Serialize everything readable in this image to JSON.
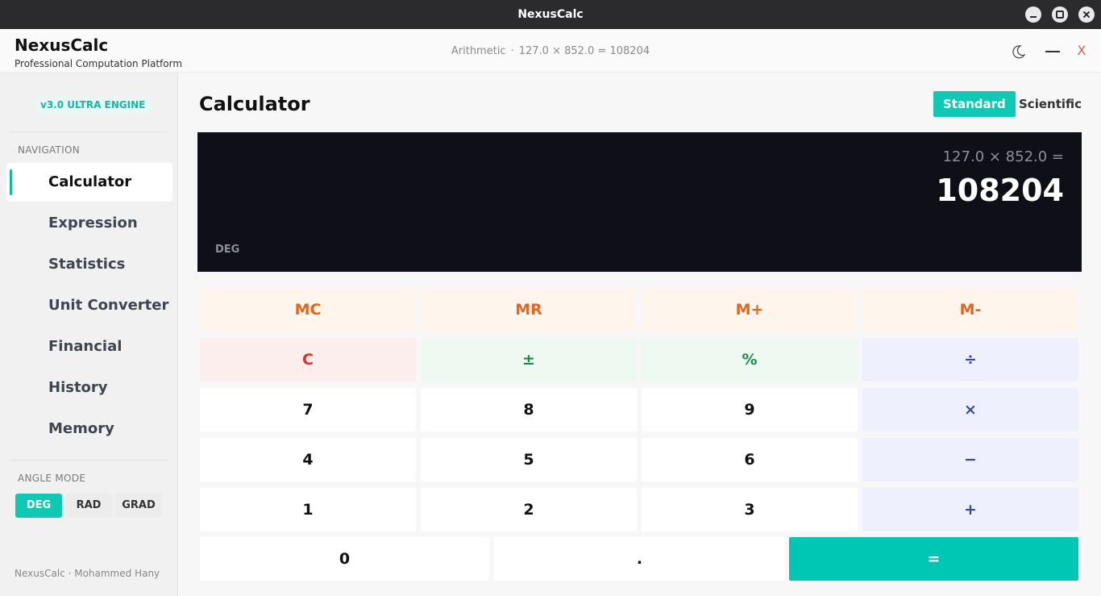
{
  "window": {
    "title": "NexusCalc"
  },
  "header": {
    "brand": "NexusCalc",
    "tagline": "Professional Computation Platform",
    "status_mode": "Arithmetic",
    "status_sep": "·",
    "status_expr": "127.0 × 852.0 = 108204"
  },
  "sidebar": {
    "version": "v3.0  ULTRA ENGINE",
    "nav_label": "NAVIGATION",
    "items": [
      {
        "label": "Calculator",
        "active": true
      },
      {
        "label": "Expression"
      },
      {
        "label": "Statistics"
      },
      {
        "label": "Unit Converter"
      },
      {
        "label": "Financial"
      },
      {
        "label": "History"
      },
      {
        "label": "Memory"
      }
    ],
    "angle_label": "ANGLE MODE",
    "angle_modes": [
      {
        "label": "DEG",
        "active": true
      },
      {
        "label": "RAD"
      },
      {
        "label": "GRAD"
      }
    ],
    "footer": "NexusCalc · Mohammed Hany"
  },
  "main": {
    "title": "Calculator",
    "tabs": [
      {
        "label": "Standard",
        "active": true
      },
      {
        "label": "Scientific"
      }
    ],
    "display": {
      "expression": "127.0 × 852.0 =",
      "result": "108204",
      "mode": "DEG"
    },
    "keys": {
      "mc": "MC",
      "mr": "MR",
      "mplus": "M+",
      "mminus": "M-",
      "clear": "C",
      "plusminus": "±",
      "percent": "%",
      "divide": "÷",
      "k7": "7",
      "k8": "8",
      "k9": "9",
      "multiply": "×",
      "k4": "4",
      "k5": "5",
      "k6": "6",
      "minus": "−",
      "k1": "1",
      "k2": "2",
      "k3": "3",
      "plus": "+",
      "k0": "0",
      "dot": ".",
      "equals": "="
    }
  },
  "colors": {
    "accent": "#10c9b4",
    "memory": "#e4661c",
    "clear": "#d6322e",
    "function": "#1d8a46",
    "operator": "#3b45b0"
  }
}
